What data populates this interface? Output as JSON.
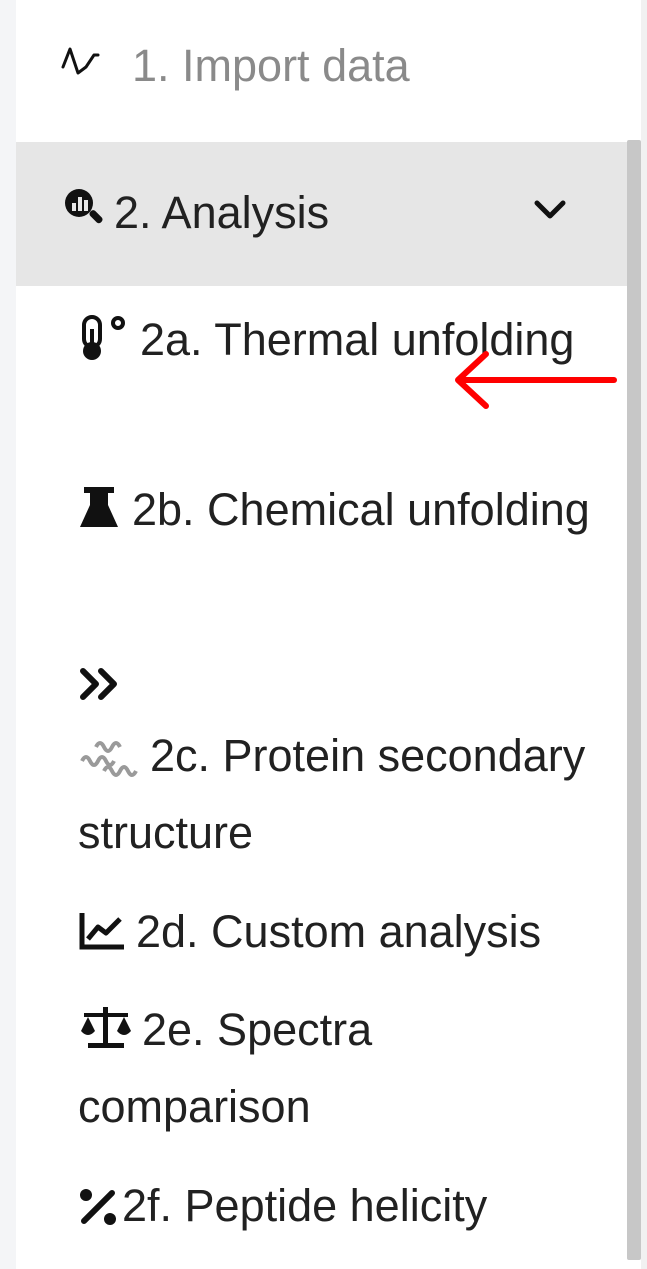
{
  "nav": {
    "import_label": "1. Import data",
    "analysis": {
      "label": "2. Analysis",
      "expanded": true,
      "items": [
        {
          "label": "2a. Thermal unfolding",
          "icon": "thermometer-icon",
          "selected": true
        },
        {
          "label": "2b. Chemical unfolding",
          "icon": "flask-icon"
        },
        {
          "label": "2c. Protein secondary structure",
          "icon": "protein-structure-icon"
        },
        {
          "label": "2d. Custom analysis",
          "icon": "chart-line-icon"
        },
        {
          "label": "2e. Spectra comparison",
          "icon": "scale-balance-icon"
        },
        {
          "label": "2f. Peptide helicity",
          "icon": "percent-icon"
        }
      ]
    }
  },
  "colors": {
    "header_bg": "#e6e6e6",
    "text": "#212121",
    "muted_text": "#8a8a8a",
    "annotation_arrow": "#ff0000",
    "scrollbar_thumb": "#c7c7c7"
  }
}
